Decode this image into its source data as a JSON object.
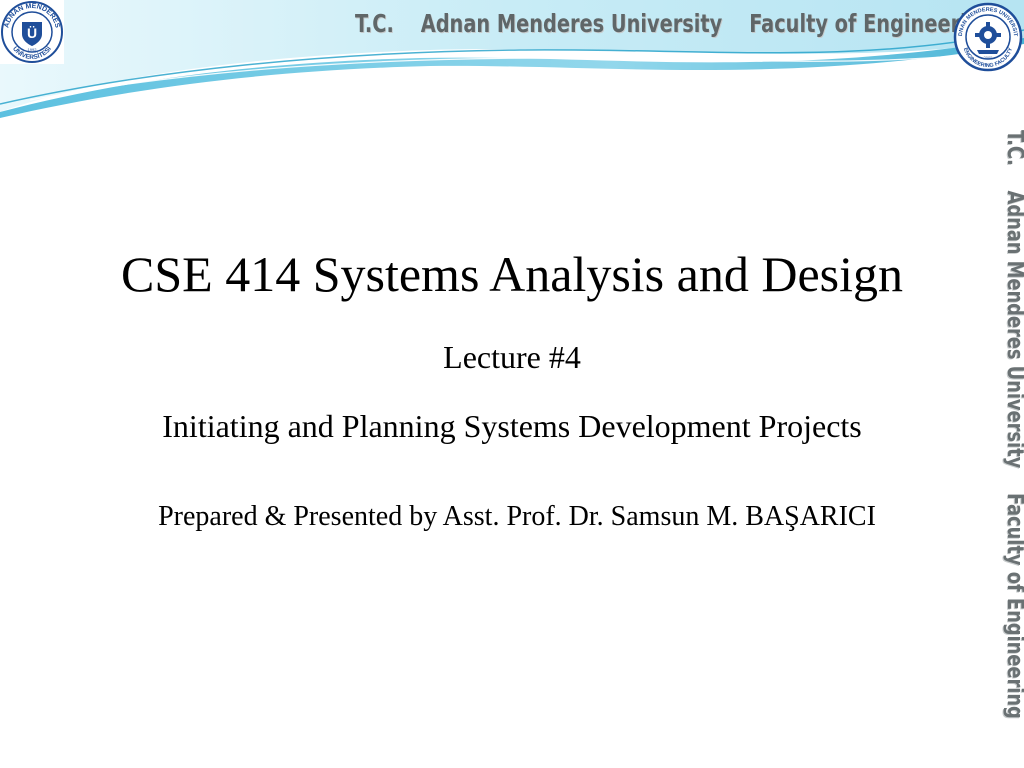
{
  "header": {
    "title": "T.C.    Adnan Menderes University    Faculty of Engineering",
    "side_text": "T.C.    Adnan Menderes University    Faculty of Engineering"
  },
  "logos": {
    "left": {
      "icon": "university-seal-icon",
      "ring_text_top": "ADNAN MENDERES",
      "ring_text_bottom": "ÜNİVERSİTESİ",
      "year": "1992",
      "center": "Ü",
      "color": "#1f4e9a"
    },
    "right": {
      "icon": "engineering-faculty-seal-icon",
      "ring_text_top": "ADNAN MENDERES UNIVERSITY",
      "ring_text_bottom": "ENGINEERING FACULTY",
      "year": "2005",
      "color": "#1f4e9a"
    }
  },
  "slide": {
    "course_title": "CSE 414 Systems Analysis and Design",
    "lecture_number": "Lecture #4",
    "lecture_subtitle": "Initiating and Planning Systems Development Projects",
    "presenter": "Prepared & Presented by Asst. Prof. Dr. Samsun M. BAŞARICI"
  },
  "colors": {
    "swoosh_light": "#c8ecf6",
    "swoosh_mid": "#7fd0e8",
    "swoosh_dark": "#2aa7cf",
    "header_text": "#5f6668"
  }
}
